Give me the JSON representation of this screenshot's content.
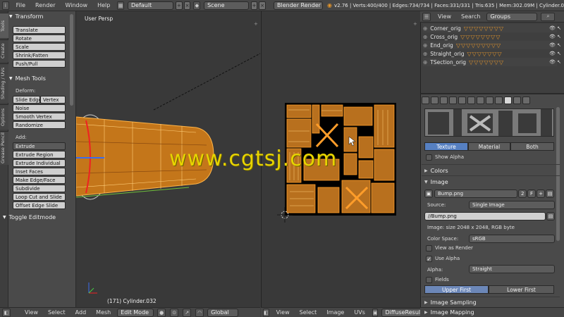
{
  "topbar": {
    "menus": [
      "File",
      "Render",
      "Window",
      "Help"
    ],
    "screen_layout": "Default",
    "scene": "Scene",
    "render_engine": "Blender Render",
    "stats": "v2.76 | Verts:400/400 | Edges:734/734 | Faces:331/331 | Tris:635 | Mem:302.09M | Cylinder.0"
  },
  "shelf": {
    "tabs": [
      "Tools",
      "Create",
      "Shading / UVs",
      "Options",
      "Grease Pencil"
    ],
    "transform_title": "Transform",
    "transform_buttons": [
      "Translate",
      "Rotate",
      "Scale",
      "Shrink/Fatten",
      "Push/Pull"
    ],
    "mesh_tools_title": "Mesh Tools",
    "deform_label": "Deform:",
    "slide_edge": "Slide Edge",
    "vertex": "Vertex",
    "noise": "Noise",
    "smooth_vertex": "Smooth Vertex",
    "randomize": "Randomize",
    "add_label": "Add:",
    "extrude": "Extrude",
    "add_buttons": [
      "Extrude Region",
      "Extrude Individual",
      "Inset Faces",
      "Make Edge/Face",
      "Subdivide",
      "Loop Cut and Slide",
      "Offset Edge Slide"
    ],
    "toggle_editmode": "Toggle Editmode"
  },
  "viewport3d": {
    "name": "User Persp",
    "object_label": "(171) Cylinder.032"
  },
  "watermark": "www.cgtsj.com",
  "bottom3d": {
    "menus": [
      "View",
      "Select",
      "Add",
      "Mesh"
    ],
    "mode": "Edit Mode",
    "orientation": "Global"
  },
  "bottomuv": {
    "menus": [
      "View",
      "Select",
      "Image",
      "UVs"
    ],
    "image": "DiffuseResult"
  },
  "outliner": {
    "view": "View",
    "search": "Search",
    "display": "Groups",
    "rows": [
      "Corner_orig",
      "Cross_orig",
      "End_orig",
      "Straight_orig",
      "TSection_orig"
    ]
  },
  "properties": {
    "tabs": [
      "Texture",
      "Material",
      "Both"
    ],
    "show_alpha": "Show Alpha",
    "colors": "Colors",
    "image_section": "Image",
    "image_name": "Bump.png",
    "users": "2",
    "fake": "F",
    "source_label": "Source:",
    "source": "Single Image",
    "filepath": "//Bump.png",
    "image_info": "Image: size 2048 x 2048, RGB byte",
    "color_space_label": "Color Space:",
    "color_space": "sRGB",
    "view_as_render": "View as Render",
    "use_alpha": "Use Alpha",
    "alpha_label": "Alpha:",
    "alpha_mode": "Straight",
    "fields": "Fields",
    "upper_first": "Upper First",
    "lower_first": "Lower First",
    "image_sampling": "Image Sampling",
    "image_mapping": "Image Mapping"
  }
}
